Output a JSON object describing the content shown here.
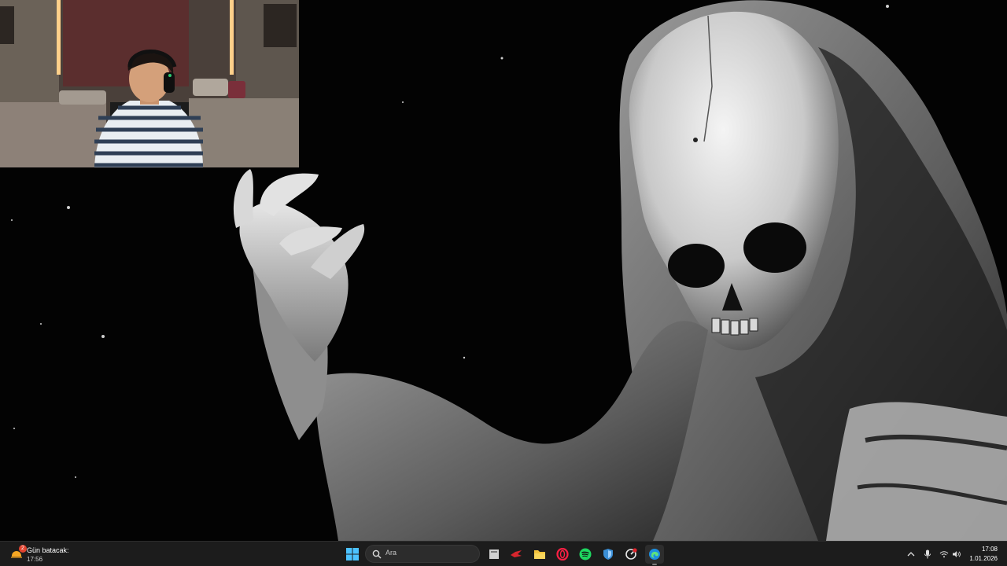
{
  "desktop": {
    "wallpaper_icon": "grim-reaper-skull-wallpaper"
  },
  "webcam": {
    "icon": "webcam-person-overlay"
  },
  "taskbar": {
    "weather": {
      "title": "Gün batacak:",
      "time": "17:56",
      "badge": "2",
      "icon": "sunset-weather-icon"
    },
    "start_icon": "windows-start-icon",
    "search": {
      "placeholder": "Ara",
      "icon": "search-icon"
    },
    "pinned": [
      {
        "name": "file-viewer-icon",
        "active": false
      },
      {
        "name": "red-app-icon",
        "active": false
      },
      {
        "name": "file-explorer-icon",
        "active": false
      },
      {
        "name": "opera-gx-icon",
        "active": false
      },
      {
        "name": "spotify-icon",
        "active": false
      },
      {
        "name": "shield-app-icon",
        "active": false
      },
      {
        "name": "steelseries-icon",
        "active": false
      },
      {
        "name": "edge-icon",
        "active": true
      }
    ],
    "tray": {
      "chevron_icon": "chevron-up-icon",
      "mic_icon": "microphone-icon",
      "wifi_icon": "wifi-icon",
      "volume_icon": "volume-icon"
    },
    "clock": {
      "time": "17:08",
      "date": "1.01.2026"
    }
  },
  "colors": {
    "taskbar_bg": "#1c1c1c",
    "accent": "#4cc2ff",
    "badge": "#e0432f"
  }
}
